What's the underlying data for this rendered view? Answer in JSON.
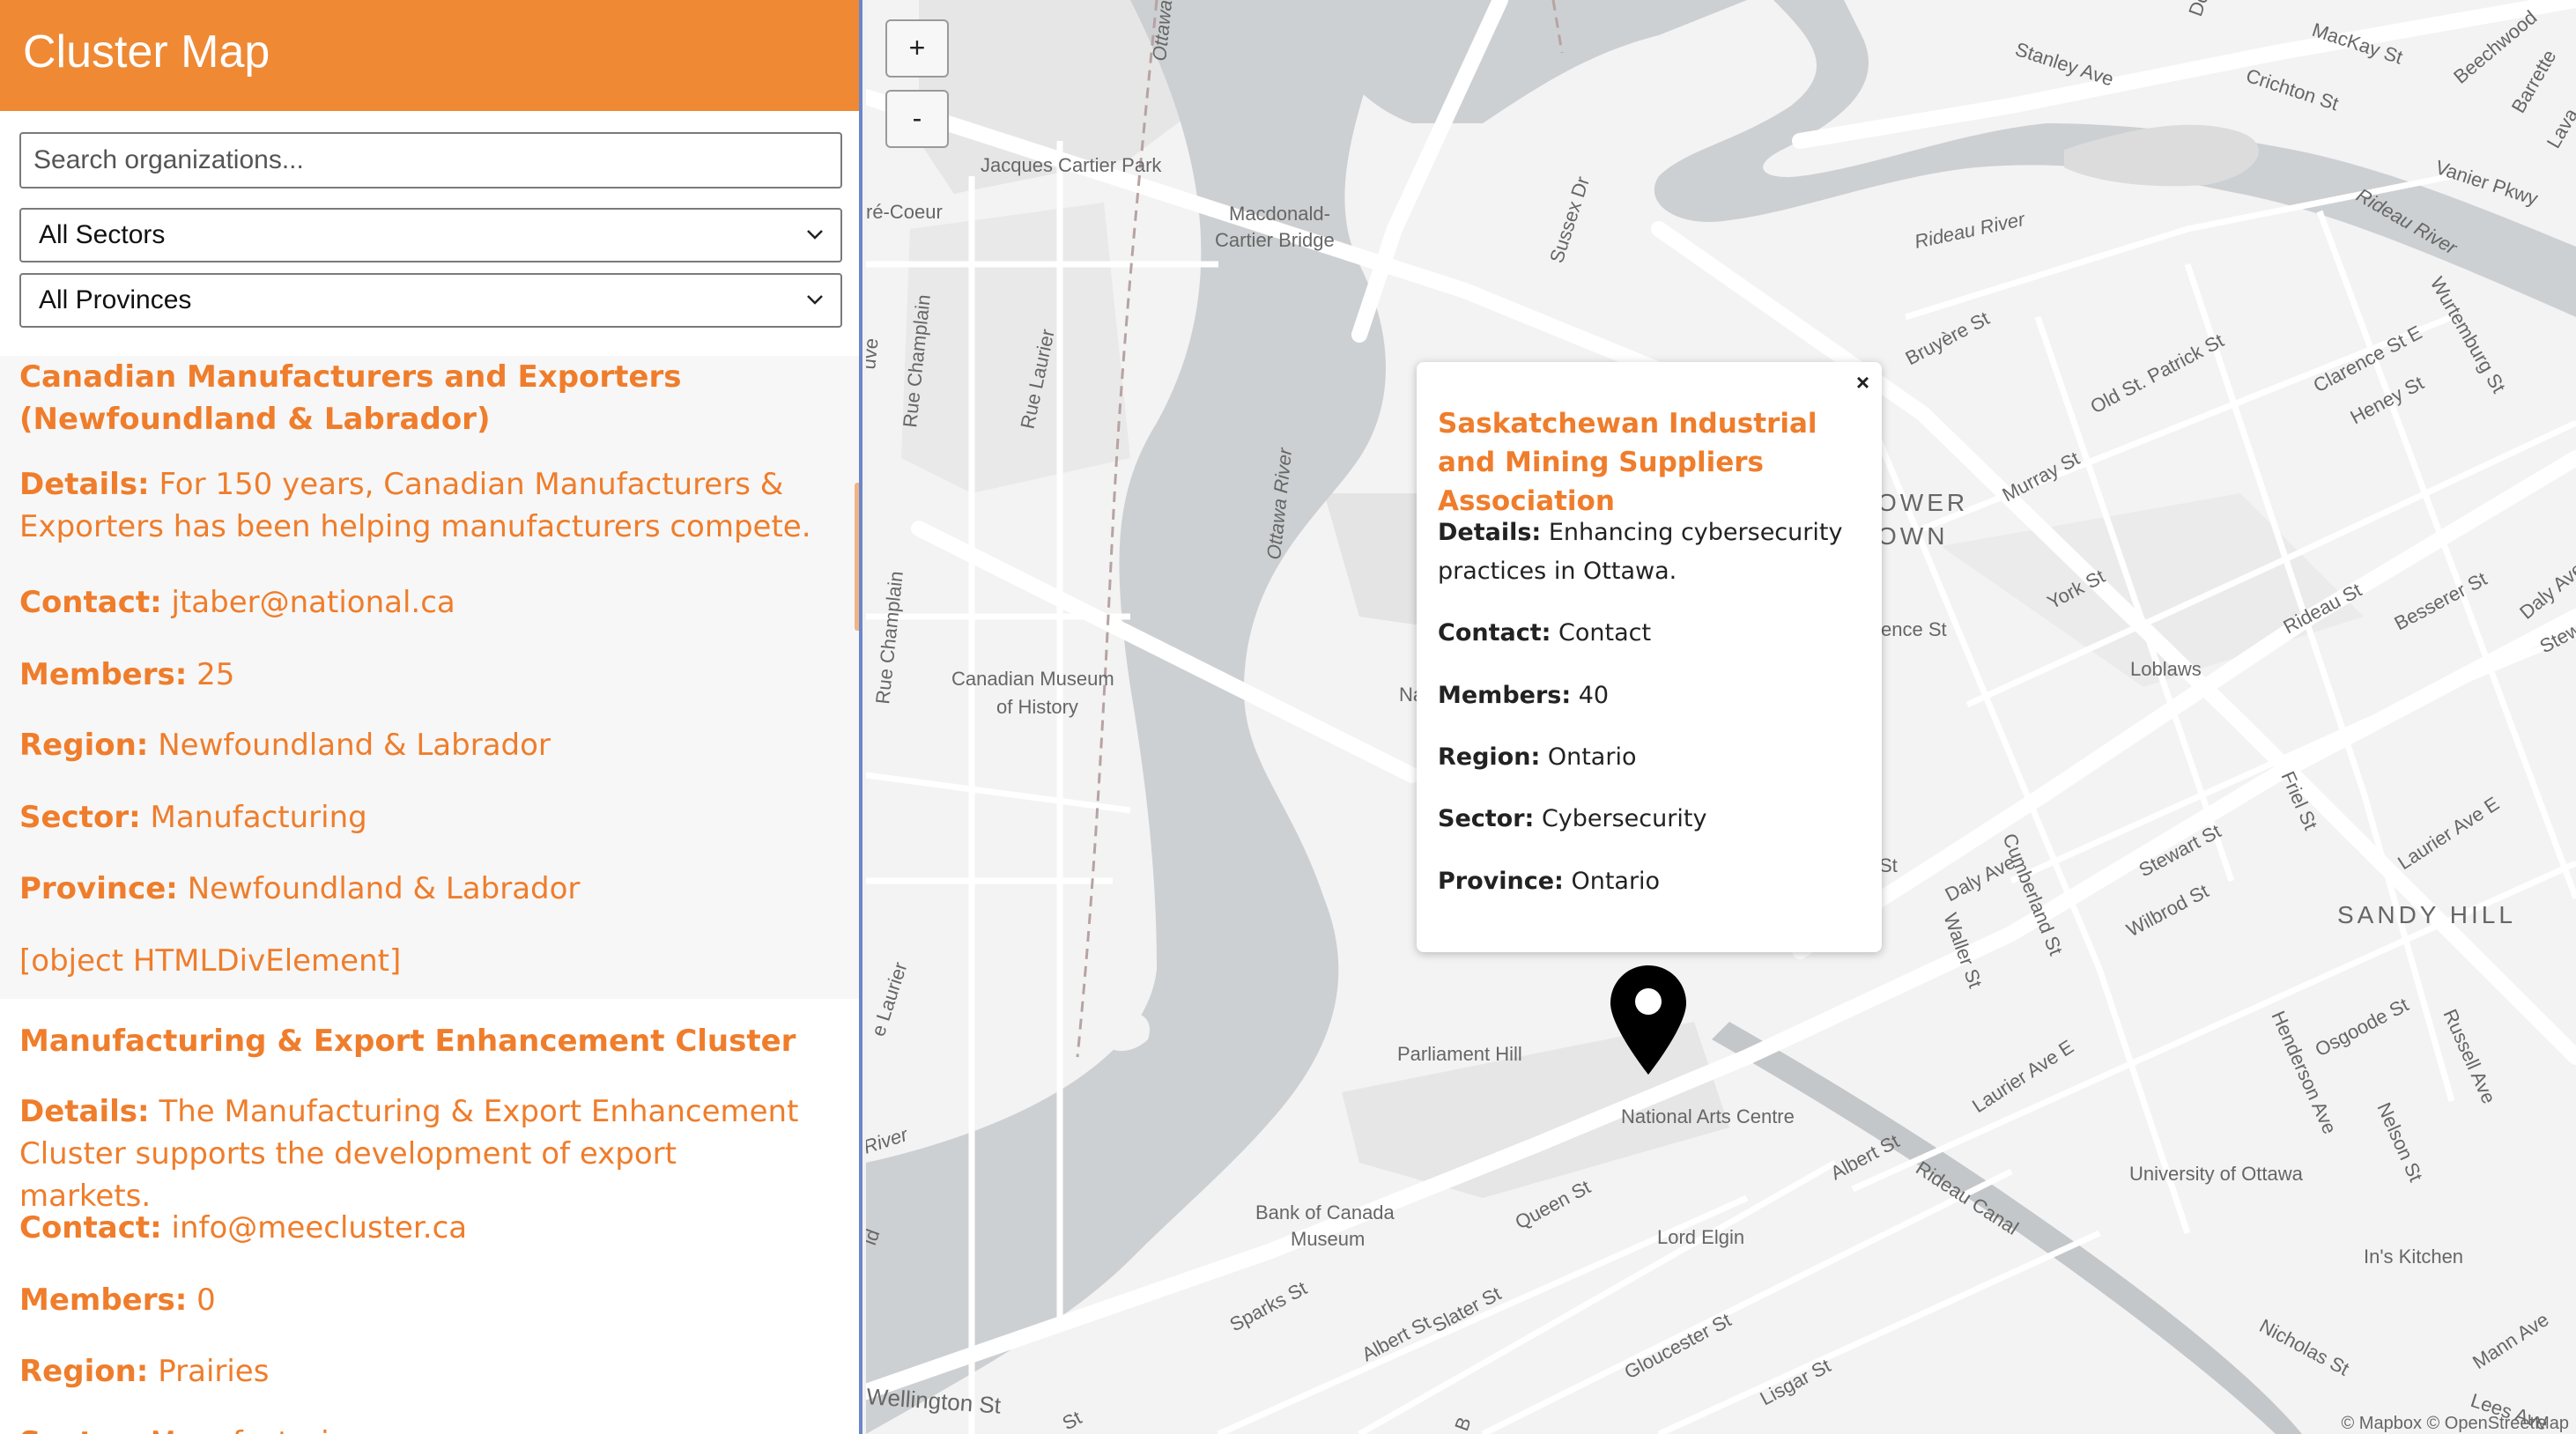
{
  "app": {
    "title": "Cluster Map"
  },
  "search": {
    "placeholder": "Search organizations..."
  },
  "filters": {
    "sector_selected": "All Sectors",
    "province_selected": "All Provinces"
  },
  "list": [
    {
      "name": "Canadian Manufacturers and Exporters (Newfoundland & Labrador)",
      "details_label": "Details:",
      "details": "For 150 years, Canadian Manufacturers & Exporters has been helping manufacturers compete.",
      "contact_label": "Contact:",
      "contact": "jtaber@national.ca",
      "members_label": "Members:",
      "members": "25",
      "region_label": "Region:",
      "region": "Newfoundland & Labrador",
      "sector_label": "Sector:",
      "sector": "Manufacturing",
      "province_label": "Province:",
      "province": "Newfoundland & Labrador",
      "extra": "[object HTMLDivElement]"
    },
    {
      "name": "Manufacturing & Export Enhancement Cluster",
      "details_label": "Details:",
      "details": "The Manufacturing & Export Enhancement Cluster supports the development of export markets.",
      "contact_label": "Contact:",
      "contact": "info@meecluster.ca",
      "members_label": "Members:",
      "members": "0",
      "region_label": "Region:",
      "region": "Prairies",
      "sector_label": "Sector:",
      "sector": "Manufacturing"
    }
  ],
  "map": {
    "zoom_in": "+",
    "zoom_out": "-",
    "popup": {
      "close": "×",
      "title": "Saskatchewan Industrial and Mining Suppliers Association",
      "details_label": "Details:",
      "details": "Enhancing cybersecurity practices in Ottawa.",
      "contact_label": "Contact:",
      "contact": "Contact",
      "members_label": "Members:",
      "members": "40",
      "region_label": "Region:",
      "region": "Ontario",
      "sector_label": "Sector:",
      "sector": "Cybersecurity",
      "province_label": "Province:",
      "province": "Ontario"
    },
    "labels": {
      "jacques_cartier_park": "Jacques Cartier Park",
      "macdonald_1": "Macdonald-",
      "macdonald_2": "Cartier Bridge",
      "sussex": "Sussex Dr",
      "ottawa_river_1": "Ottawa River",
      "ottawa_river_2": "Ottawa River",
      "ottawa_river_3": "River",
      "rideau_river_1": "Rideau River",
      "rideau_river_2": "Rideau River",
      "rue_champlain_1": "Rue Champlain",
      "rue_champlain_2": "Rue Champlain",
      "rue_laurier_1": "Rue Laurier",
      "rue_laurier_2": "Rue Laurier",
      "re_coeur": "ré-Coeur",
      "museum_1": "Canadian Museum",
      "museum_2": "of History",
      "parliament_hill": "Parliament Hill",
      "nac": "National Arts Centre",
      "bank_1": "Bank of Canada",
      "bank_2": "Museum",
      "lord_elgin": "Lord Elgin",
      "wellington": "Wellington St",
      "sparks": "Sparks St",
      "albert_1": "Albert St",
      "albert_2": "Albert St",
      "queen": "Queen St",
      "slater": "Slater St",
      "gloucester": "Gloucester St",
      "lisgar": "Lisgar St",
      "daly": "Daly Ave",
      "laurier_e_1": "Laurier Ave E",
      "laurier_e_2": "Laurier Ave E",
      "waller": "Waller St",
      "cumberland": "Cumberland St",
      "stewart_1": "Stewart St",
      "stewart_2": "Stewart",
      "wilbrod": "Wilbrod St",
      "friel": "Friel St",
      "sandy_hill": "SANDY HILL",
      "henderson": "Henderson Ave",
      "osgoode": "Osgoode St",
      "nelson": "Nelson St",
      "russell": "Russell Ave",
      "uottawa": "University of Ottawa",
      "ins_kitchen": "In's Kitchen",
      "nicholas": "Nicholas St",
      "rideau_canal": "Rideau Canal",
      "mann": "Mann Ave",
      "lees": "Lees Ave",
      "loblaws": "Loblaws",
      "rideau_st": "Rideau St",
      "besserer": "Besserer St",
      "daly_ave_2": "Daly Ave",
      "york": "York St",
      "murray": "Murray St",
      "old_st_patrick": "Old St. Patrick St",
      "clarence_e": "Clarence St E",
      "heney": "Heney St",
      "wurtemburg": "Wurtemburg St",
      "bruyere": "Bruyère St",
      "lower_1": "OWER",
      "lower_2": "OWN",
      "stanley": "Stanley Ave",
      "mackay": "MacKay St",
      "crichton": "Crichton St",
      "beechwood": "Beechwood",
      "barrette": "Barrette",
      "vanier": "Vanier Pkwy",
      "lava": "Lava",
      "clarence_frag": "ence St",
      "st_frag": "St",
      "na_frag": "Na",
      "e_frag": "e Laurier",
      "id_frag": "id",
      "d_frag": "Do",
      "rue_frag": "uvé",
      "st_frag2": "St",
      "b_frag": "B"
    },
    "attribution": "© Mapbox © OpenStreetMap"
  }
}
